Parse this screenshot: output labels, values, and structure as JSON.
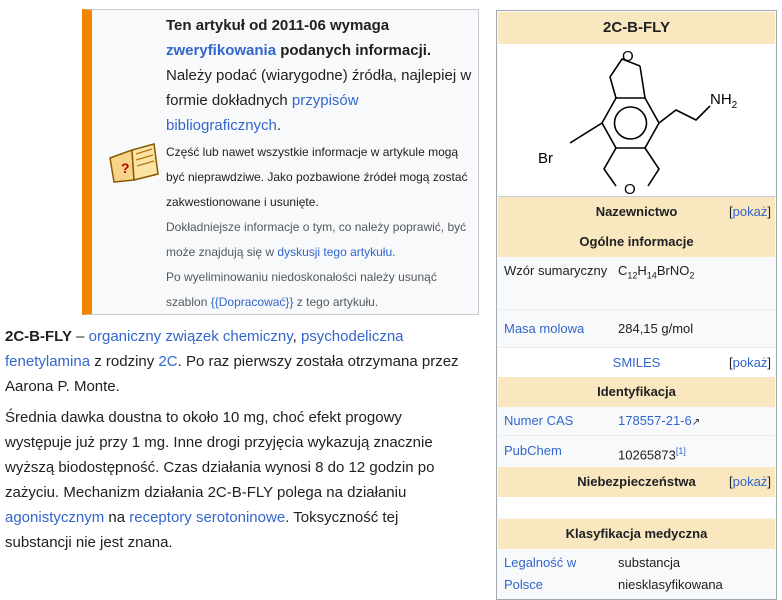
{
  "notice": {
    "main_bold_1": "Ten artykuł od 2011-06 wymaga",
    "main_link": "zweryfikowania",
    "main_bold_2": "podanych informacji.",
    "main_text_1": "Należy podać (wiarygodne) źródła, najlepiej w formie dokładnych",
    "main_link_2": "przypisów bibliograficznych",
    "main_text_2": ".",
    "sub_1": "Część lub nawet wszystkie informacje w artykule mogą być nieprawdziwe. Jako pozbawione źródeł mogą zostać zakwestionowane i usunięte.",
    "sub_2_text": "Dokładniejsze informacje o tym, co należy poprawić, być może znajdują się w",
    "sub_2_link": "dyskusji tego artykułu",
    "sub_2_end": ".",
    "sub_3_text": "Po wyeliminowaniu niedoskonałości należy usunąć szablon",
    "sub_3_link": "{{Dopracować}}",
    "sub_3_end": "z tego artykułu.",
    "icon": "book-icon"
  },
  "article": {
    "p1": {
      "bold": "2C-B-FLY",
      "t1": " – ",
      "l1": "organiczny związek chemiczny",
      "t2": ", ",
      "l2": "psychodeliczna fenetylamina",
      "t3": " z rodziny ",
      "l3": "2C",
      "t4": ". Po raz pierwszy została otrzymana przez Aarona P. Monte."
    },
    "p2": {
      "t1": "Średnia dawka doustna to około 10 mg, choć efekt progowy występuje już przy 1 mg. Inne drogi przyjęcia wykazują znacznie wyższą biodostępność. Czas działania wynosi 8 do 12 godzin po zażyciu. Mechanizm działania 2C-B-FLY polega na działaniu ",
      "l1": "agonistycznym",
      "t2": " na ",
      "l2": "receptory serotoninowe",
      "t3": ". Toksyczność tej substancji nie jest znana."
    }
  },
  "infobox": {
    "title": "2C-B-FLY",
    "structure": {
      "label_nh2": "NH",
      "label_nh2_sub": "2",
      "label_br": "Br",
      "label_o": "O"
    },
    "toggle_open": "[",
    "toggle_link": "pokaż",
    "toggle_close": "]",
    "sections": {
      "nazewnictwo": "Nazewnictwo",
      "ogolne": "Ogólne informacje",
      "identyfikacja": "Identyfikacja",
      "niebezpieczenstwa": "Niebezpieczeństwa",
      "klasyfikacja": "Klasyfikacja medyczna"
    },
    "wzor_label": "Wzór sumaryczny",
    "formula": {
      "c": "C",
      "c_n": "12",
      "h": "H",
      "h_n": "14",
      "rest": "BrNO",
      "o_n": "2"
    },
    "masa_label": "Masa molowa",
    "masa_value": "284,15 g/mol",
    "smiles_label": "SMILES",
    "cas_label": "Numer CAS",
    "cas_value": "178557-21-6",
    "pubchem_label": "PubChem",
    "pubchem_value": "10265873",
    "pubchem_ref": "[1]",
    "legal_label": "Legalność w Polsce",
    "legal_value": "substancja niesklasyfikowana"
  }
}
